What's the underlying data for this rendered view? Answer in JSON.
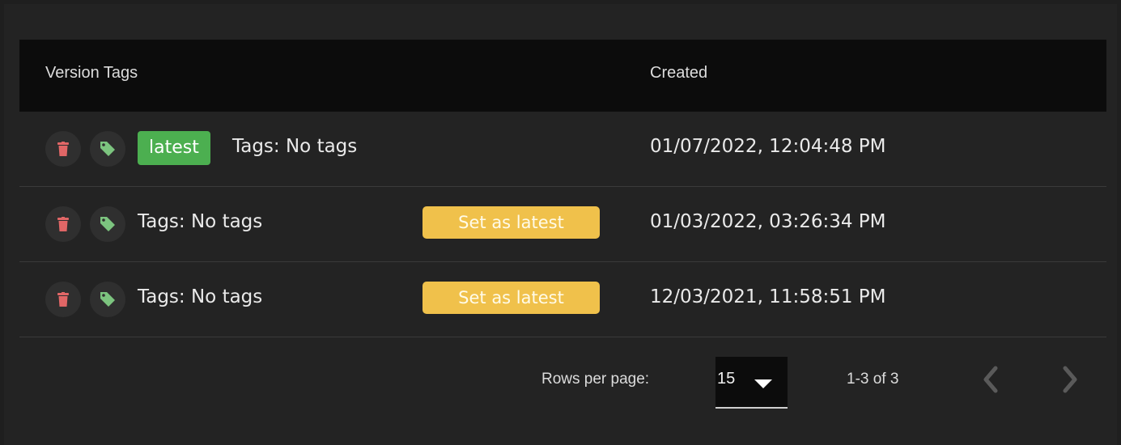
{
  "table": {
    "headers": {
      "tags": "Version Tags",
      "created": "Created"
    },
    "rows": [
      {
        "is_latest": true,
        "latest_label": "latest",
        "tags_text": "Tags: No tags",
        "action_label": "",
        "created": "01/07/2022, 12:04:48 PM"
      },
      {
        "is_latest": false,
        "latest_label": "",
        "tags_text": "Tags: No tags",
        "action_label": "Set as latest",
        "created": "01/03/2022, 03:26:34 PM"
      },
      {
        "is_latest": false,
        "latest_label": "",
        "tags_text": "Tags: No tags",
        "action_label": "Set as latest",
        "created": "12/03/2021, 11:58:51 PM"
      }
    ]
  },
  "pagination": {
    "rows_per_page_label": "Rows per page:",
    "rows_per_page_value": "15",
    "range_text": "1-3 of 3"
  },
  "icons": {
    "delete": "trash-icon",
    "tag": "tag-icon",
    "dropdown": "caret-down-icon",
    "prev": "chevron-left-icon",
    "next": "chevron-right-icon"
  },
  "colors": {
    "delete_icon": "#e06666",
    "tag_icon": "#7cc47f",
    "latest_badge": "#4caf50",
    "set_latest_button": "#f0c14b"
  }
}
